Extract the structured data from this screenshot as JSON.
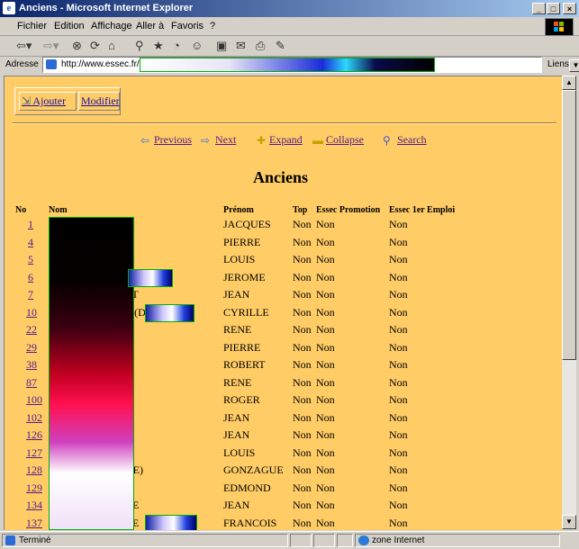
{
  "window": {
    "title": "Anciens - Microsoft Internet Explorer",
    "min_label": "_",
    "max_label": "□",
    "close_label": "×"
  },
  "menu": [
    "Fichier",
    "Edition",
    "Affichage",
    "Aller à",
    "Favoris",
    "?"
  ],
  "address": {
    "label": "Adresse",
    "url": "http://www.essec.fr/",
    "links_label": "Liens"
  },
  "page": {
    "buttons": {
      "add": "Ajouter",
      "edit": "Modifier"
    },
    "nav": {
      "previous": "Previous",
      "next": "Next",
      "expand": "Expand",
      "collapse": "Collapse",
      "search": "Search"
    },
    "heading": "Anciens",
    "columns": [
      "No",
      "Nom",
      "Prénom",
      "Top",
      "Essec Promotion",
      "Essec 1er Emploi"
    ],
    "rows": [
      {
        "no": "1",
        "nom": "",
        "prenom": "JACQUES",
        "top": "Non",
        "promo": "Non",
        "emploi": "Non"
      },
      {
        "no": "4",
        "nom": "",
        "prenom": "PIERRE",
        "top": "Non",
        "promo": "Non",
        "emploi": "Non"
      },
      {
        "no": "5",
        "nom": "",
        "prenom": "LOUIS",
        "top": "Non",
        "promo": "Non",
        "emploi": "Non"
      },
      {
        "no": "6",
        "nom": "",
        "prenom": "JEROME",
        "top": "Non",
        "promo": "Non",
        "emploi": "Non"
      },
      {
        "no": "7",
        "nom": "ET",
        "prenom": "JEAN",
        "top": "Non",
        "promo": "Non",
        "emploi": "Non"
      },
      {
        "no": "10",
        "nom": "T (DE)",
        "prenom": "CYRILLE",
        "top": "Non",
        "promo": "Non",
        "emploi": "Non"
      },
      {
        "no": "22",
        "nom": "",
        "prenom": "RENE",
        "top": "Non",
        "promo": "Non",
        "emploi": "Non"
      },
      {
        "no": "29",
        "nom": "",
        "prenom": "PIERRE",
        "top": "Non",
        "promo": "Non",
        "emploi": "Non"
      },
      {
        "no": "38",
        "nom": "",
        "prenom": "ROBERT",
        "top": "Non",
        "promo": "Non",
        "emploi": "Non"
      },
      {
        "no": "87",
        "nom": "",
        "prenom": "RENE",
        "top": "Non",
        "promo": "Non",
        "emploi": "Non"
      },
      {
        "no": "100",
        "nom": "",
        "prenom": "ROGER",
        "top": "Non",
        "promo": "Non",
        "emploi": "Non"
      },
      {
        "no": "102",
        "nom": "",
        "prenom": "JEAN",
        "top": "Non",
        "promo": "Non",
        "emploi": "Non"
      },
      {
        "no": "126",
        "nom": "",
        "prenom": "JEAN",
        "top": "Non",
        "promo": "Non",
        "emploi": "Non"
      },
      {
        "no": "127",
        "nom": "",
        "prenom": "LOUIS",
        "top": "Non",
        "promo": "Non",
        "emploi": "Non"
      },
      {
        "no": "128",
        "nom": "DE)",
        "prenom": "GONZAGUE",
        "top": "Non",
        "promo": "Non",
        "emploi": "Non"
      },
      {
        "no": "129",
        "nom": "",
        "prenom": "EDMOND",
        "top": "Non",
        "promo": "Non",
        "emploi": "Non"
      },
      {
        "no": "134",
        "nom": "RE",
        "prenom": "JEAN",
        "top": "Non",
        "promo": "Non",
        "emploi": "Non"
      },
      {
        "no": "137",
        "nom": "RE",
        "prenom": "FRANCOIS",
        "top": "Non",
        "promo": "Non",
        "emploi": "Non"
      }
    ]
  },
  "status": {
    "text": "Terminé",
    "zone": "zone Internet"
  },
  "colors": {
    "page_bg": "#ffcc66",
    "link": "#551a8b",
    "titlebar": "#0a246a"
  }
}
